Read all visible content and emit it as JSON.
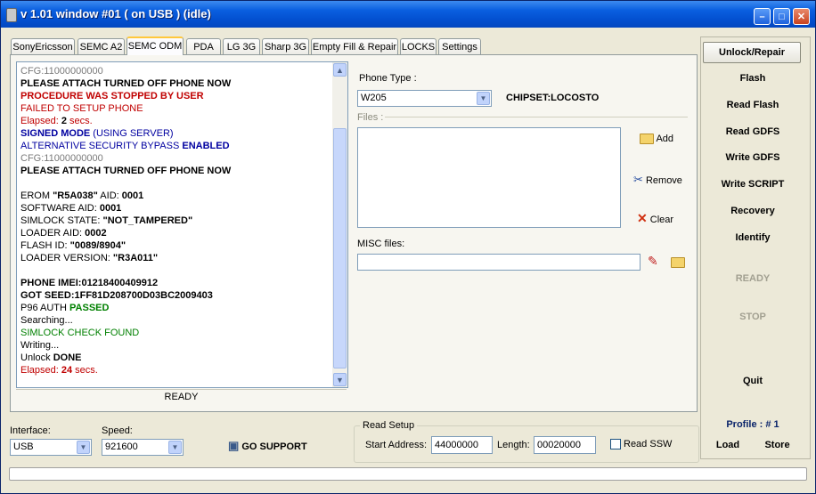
{
  "window": {
    "title": "v 1.01 window #01 ( on USB ) (idle)"
  },
  "tabs": [
    "SonyEricsson",
    "SEMC A2",
    "SEMC ODM",
    "PDA",
    "LG 3G",
    "Sharp 3G",
    "Empty Fill & Repair",
    "LOCKS",
    "Settings"
  ],
  "active_tab": "SEMC ODM",
  "log": {
    "l0": "CFG:11000000000",
    "l1": "PLEASE ATTACH TURNED OFF PHONE NOW",
    "l2": "PROCEDURE WAS STOPPED BY USER",
    "l3": "FAILED TO SETUP PHONE",
    "l4a": "Elapsed: ",
    "l4b": "2",
    "l4c": " secs.",
    "l5a": "SIGNED MODE",
    "l5b": " (USING SERVER)",
    "l6a": "ALTERNATIVE SECURITY BYPASS ",
    "l6b": "ENABLED",
    "l7": "CFG:11000000000",
    "l8": "PLEASE ATTACH TURNED OFF PHONE NOW",
    "l10a": "EROM ",
    "l10b": "\"R5A038\"",
    "l10c": " AID: ",
    "l10d": "0001",
    "l11a": "SOFTWARE AID: ",
    "l11b": "0001",
    "l12a": "SIMLOCK STATE: ",
    "l12b": "\"NOT_TAMPERED\"",
    "l13a": "LOADER AID: ",
    "l13b": "0002",
    "l14a": "FLASH ID: ",
    "l14b": "\"0089/8904\"",
    "l15a": "LOADER VERSION: ",
    "l15b": "\"R3A011\"",
    "l17": "PHONE IMEI:01218400409912",
    "l18": "GOT SEED:1FF81D208700D03BC2009403",
    "l19a": "P96 AUTH ",
    "l19b": "PASSED",
    "l20": "Searching...",
    "l21": "SIMLOCK CHECK FOUND",
    "l22": "Writing...",
    "l23a": "Unlock ",
    "l23b": "DONE",
    "l24a": "Elapsed: ",
    "l24b": "24",
    "l24c": " secs.",
    "status": "READY"
  },
  "phone": {
    "type_label": "Phone Type :",
    "type_value": "W205",
    "chipset": "CHIPSET:LOCOSTO",
    "files_label": "Files :",
    "add": "Add",
    "remove": "Remove",
    "clear": "Clear",
    "misc_label": "MISC files:"
  },
  "sidebar": {
    "unlock": "Unlock/Repair",
    "flash": "Flash",
    "read_flash": "Read Flash",
    "read_gdfs": "Read GDFS",
    "write_gdfs": "Write GDFS",
    "write_script": "Write SCRIPT",
    "recovery": "Recovery",
    "identify": "Identify",
    "ready": "READY",
    "stop": "STOP",
    "quit": "Quit",
    "profile": "Profile : # 1",
    "load": "Load",
    "store": "Store"
  },
  "bottom": {
    "interface_label": "Interface:",
    "interface_value": "USB",
    "speed_label": "Speed:",
    "speed_value": "921600",
    "go_support": "GO SUPPORT",
    "read_setup": "Read Setup",
    "start_address_label": "Start Address:",
    "start_address_value": "44000000",
    "length_label": "Length:",
    "length_value": "00020000",
    "read_ssw": "Read SSW"
  }
}
